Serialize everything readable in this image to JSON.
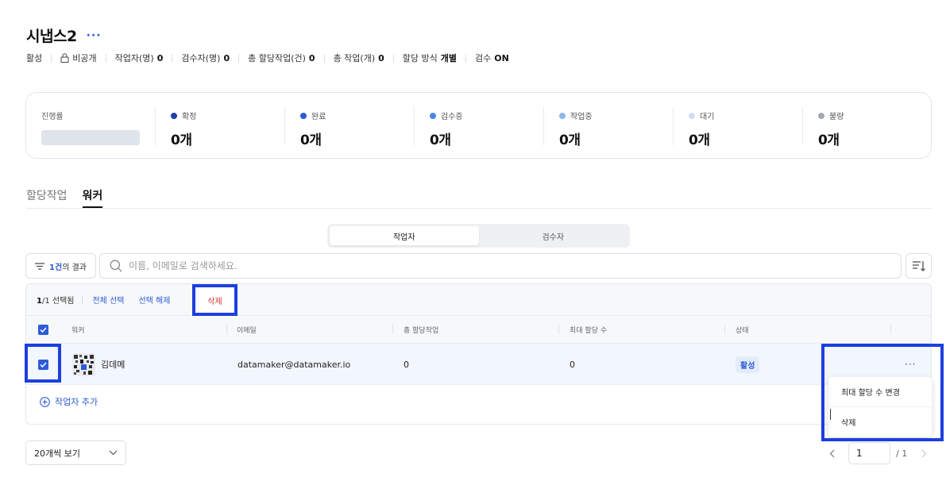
{
  "project": {
    "title": "시냅스2",
    "more": "···"
  },
  "meta": {
    "status": "활성",
    "visibility": "비공개",
    "workers_label": "작업자(명)",
    "workers_value": "0",
    "reviewers_label": "검수자(명)",
    "reviewers_value": "0",
    "assigned_label": "총 할당작업(건)",
    "assigned_value": "0",
    "total_label": "총 작업(개)",
    "total_value": "0",
    "method_label": "할당 방식",
    "method_value": "개별",
    "review_label": "검수",
    "review_value": "ON"
  },
  "progress": {
    "label": "진행률",
    "fill": 0,
    "stats": [
      {
        "label": "확정",
        "value": "0개",
        "color": "#1f3fa8"
      },
      {
        "label": "완료",
        "value": "0개",
        "color": "#2d5bd7"
      },
      {
        "label": "검수중",
        "value": "0개",
        "color": "#4a86e8"
      },
      {
        "label": "작업중",
        "value": "0개",
        "color": "#8eb6f0"
      },
      {
        "label": "대기",
        "value": "0개",
        "color": "#cfdef7"
      },
      {
        "label": "불량",
        "value": "0개",
        "color": "#a3a9b3"
      }
    ]
  },
  "tabs": [
    {
      "label": "할당작업"
    },
    {
      "label": "워커"
    }
  ],
  "segment": [
    {
      "label": "작업자"
    },
    {
      "label": "검수자"
    }
  ],
  "filter": {
    "count": "1건",
    "suffix": "의 결과"
  },
  "search": {
    "placeholder": "이름, 이메일로 검색하세요."
  },
  "selection": {
    "selected": "1",
    "total": "/1 선택됨",
    "select_all": "전체 선택",
    "deselect": "선택 해제",
    "delete": "삭제"
  },
  "table": {
    "columns": [
      "워커",
      "이메일",
      "총 할당작업",
      "최대 할당 수",
      "상태"
    ],
    "rows": [
      {
        "name": "김데메",
        "email": "datamaker@datamaker.io",
        "assigned": "0",
        "max_assign": "0",
        "status": "활성",
        "more": "···"
      }
    ]
  },
  "add_worker": "작업자 추가",
  "row_menu": [
    {
      "label": "최대 할당 수 변경"
    },
    {
      "label": "삭제"
    }
  ],
  "footer": {
    "page_size": "20개씩 보기",
    "current_page": "1",
    "total_pages": "/ 1"
  },
  "colors": {
    "accent": "#2d5bd7",
    "highlight": "#1c3fe0",
    "danger": "#d2322d"
  }
}
